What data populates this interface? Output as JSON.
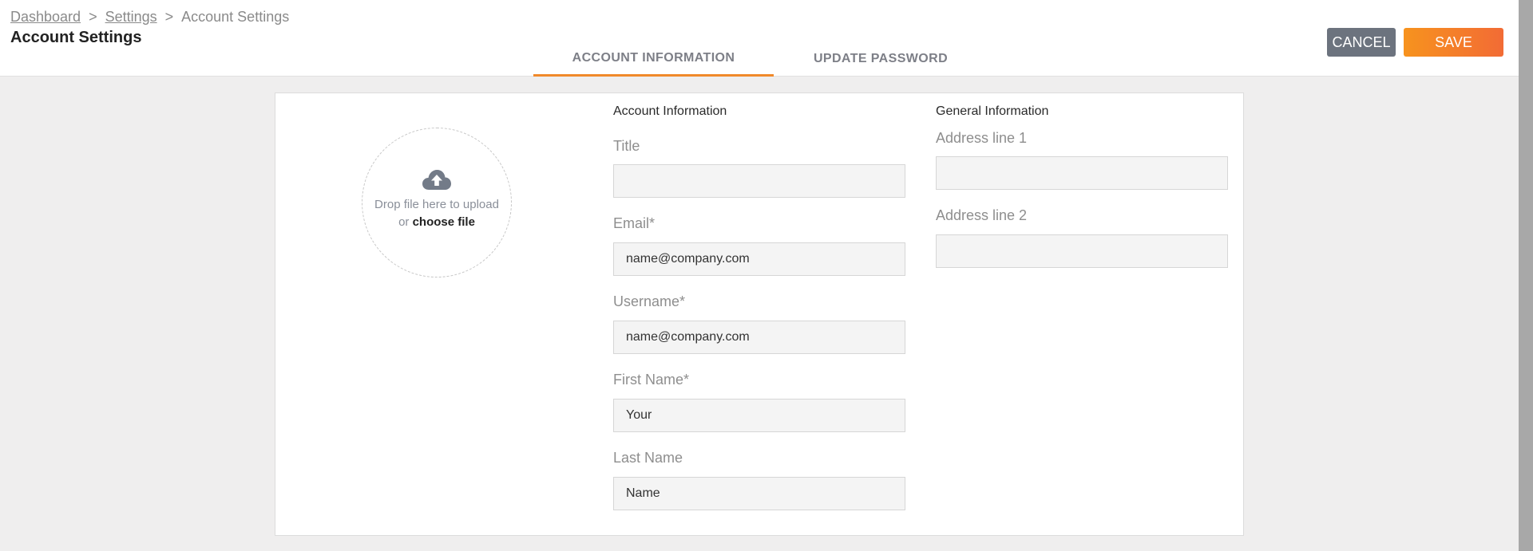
{
  "breadcrumb": {
    "items": [
      "Dashboard",
      "Settings",
      "Account Settings"
    ],
    "separator": ">"
  },
  "page": {
    "title": "Account Settings"
  },
  "tabs": [
    {
      "label": "ACCOUNT INFORMATION",
      "active": true
    },
    {
      "label": "UPDATE PASSWORD",
      "active": false
    }
  ],
  "actions": {
    "cancel_label": "CANCEL",
    "save_label": "SAVE"
  },
  "upload": {
    "icon": "cloud-upload-icon",
    "line1": "Drop file here to upload",
    "or_text": "or",
    "choose_label": "choose file"
  },
  "account_info": {
    "title": "Account Information",
    "fields": [
      {
        "label": "Title",
        "value": ""
      },
      {
        "label": "Email*",
        "value": "name@company.com"
      },
      {
        "label": "Username*",
        "value": "name@company.com"
      },
      {
        "label": "First Name*",
        "value": "Your"
      },
      {
        "label": "Last Name",
        "value": "Name"
      }
    ]
  },
  "general_info": {
    "title": "General Information",
    "fields": [
      {
        "label": "Address line 1",
        "value": ""
      },
      {
        "label": "Address line 2",
        "value": ""
      }
    ]
  },
  "colors": {
    "accent": "#f0892a",
    "save_start": "#f7931e",
    "save_end": "#f26b35",
    "cancel": "#6c737e",
    "page_bg": "#efeeee"
  }
}
